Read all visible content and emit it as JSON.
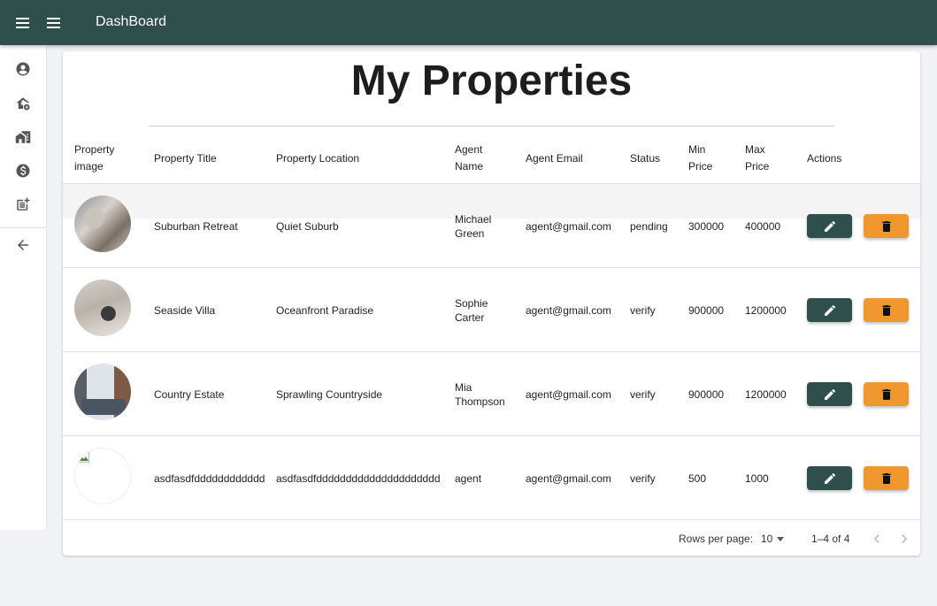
{
  "appbar": {
    "title": "DashBoard"
  },
  "sidebar": {
    "items": [
      {
        "icon": "account-circle-icon"
      },
      {
        "icon": "add-home-icon"
      },
      {
        "icon": "home-work-icon"
      },
      {
        "icon": "monetization-icon"
      },
      {
        "icon": "post-add-icon"
      },
      {
        "icon": "arrow-back-icon"
      }
    ]
  },
  "page": {
    "heading": "My Properties"
  },
  "table": {
    "headers": {
      "image_line1": "Property",
      "image_line2": "image",
      "title": "Property Title",
      "location": "Property Location",
      "agent_line1": "Agent",
      "agent_line2": "Name",
      "email": "Agent Email",
      "status": "Status",
      "min_line1": "Min",
      "min_line2": "Price",
      "max_line1": "Max",
      "max_line2": "Price",
      "actions": "Actions"
    },
    "rows": [
      {
        "title": "Suburban Retreat",
        "location": "Quiet Suburb",
        "agent_first": "Michael",
        "agent_last": "Green",
        "email": "agent@gmail.com",
        "status": "pending",
        "min": "300000",
        "max": "400000"
      },
      {
        "title": "Seaside Villa",
        "location": "Oceanfront Paradise",
        "agent_first": "Sophie",
        "agent_last": "Carter",
        "email": "agent@gmail.com",
        "status": "verify",
        "min": "900000",
        "max": "1200000"
      },
      {
        "title": "Country Estate",
        "location": "Sprawling Countryside",
        "agent_first": "Mia",
        "agent_last": "Thompson",
        "email": "agent@gmail.com",
        "status": "verify",
        "min": "900000",
        "max": "1200000"
      },
      {
        "title": "asdfasdfdddddddddddd",
        "location": "asdfasdfddddddddddddddddddddd",
        "agent_first": "agent",
        "agent_last": "",
        "email": "agent@gmail.com",
        "status": "verify",
        "min": "500",
        "max": "1000"
      }
    ]
  },
  "pagination": {
    "rows_per_page_label": "Rows per page:",
    "rows_per_page_value": "10",
    "range": "1–4 of 4"
  },
  "colors": {
    "primary": "#2e4f4b",
    "delete": "#f0982f",
    "background": "#f2f3f7"
  }
}
